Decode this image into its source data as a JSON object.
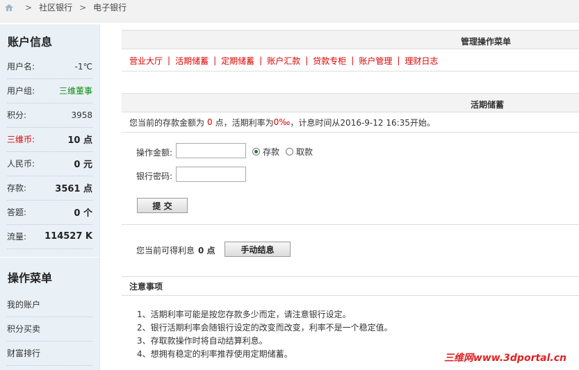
{
  "breadcrumb": {
    "sep": ">",
    "items": [
      "社区银行",
      "电子银行"
    ]
  },
  "sidebar": {
    "account_title": "账户信息",
    "rows": [
      {
        "label": "用户名:",
        "value": "-1℃"
      },
      {
        "label": "用户组:",
        "value": "三维董事"
      },
      {
        "label": "积分:",
        "value": "3958"
      },
      {
        "label": "三维币:",
        "value": "10 点"
      },
      {
        "label": "人民币:",
        "value": "0 元"
      },
      {
        "label": "存款:",
        "value": "3561 点"
      },
      {
        "label": "答题:",
        "value": "0 个"
      },
      {
        "label": "流量:",
        "value": "114527 K"
      }
    ],
    "menu_title": "操作菜单",
    "menu": [
      "我的账户",
      "积分买卖",
      "财富排行"
    ]
  },
  "menu_panel": {
    "title": "管理操作菜单",
    "sep": "|",
    "items": [
      "营业大厅",
      "活期储蓄",
      "定期储蓄",
      "账户汇款",
      "贷款专柜",
      "账户管理",
      "理财日志"
    ]
  },
  "demand": {
    "title": "活期储蓄",
    "info_1": "您当前的存款金额为",
    "balance": "0",
    "info_2": "点，活期利率为",
    "rate": "0‰",
    "info_3": "，计息时间从2016-9-12 16:35开始。",
    "amount_label": "操作金额:",
    "amount_value": "",
    "deposit_label": "存款",
    "withdraw_label": "取款",
    "password_label": "银行密码:",
    "password_value": "",
    "submit_label": "提 交",
    "interest_1": "您当前可得利息",
    "interest_value": "0 点",
    "settle_label": "手动结息"
  },
  "notes": {
    "title": "注意事项",
    "items": [
      "1、活期利率可能是按您存款多少而定，请注意银行设定。",
      "2、银行活期利率会随银行设定的改变而改变，利率不是一个稳定值。",
      "3、存取款操作时将自动结算利息。",
      "4、想拥有稳定的利率推荐使用定期储蓄。"
    ]
  },
  "watermark": "三维网www.3dportal.cn",
  "colors": {
    "accent_red": "#dd0000",
    "group_green": "#0a8a0a",
    "sidebar_bg": "#e9f1f7"
  },
  "icons": {
    "home": "home-icon"
  }
}
